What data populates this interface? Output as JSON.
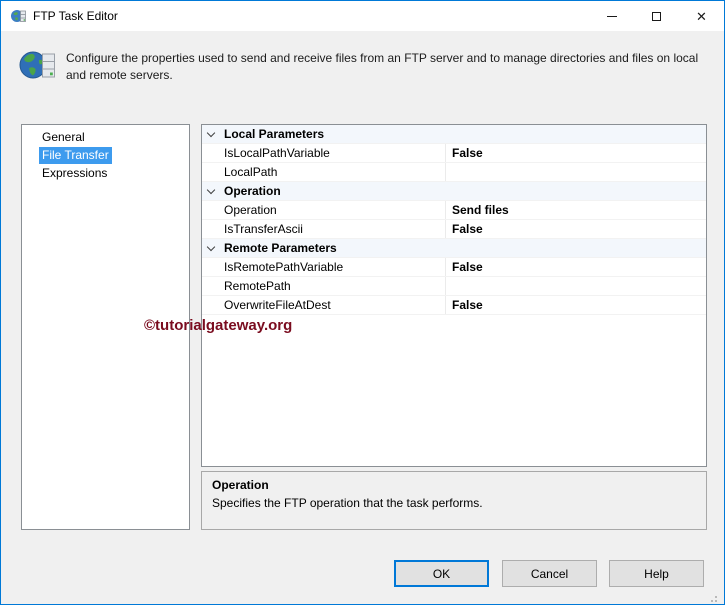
{
  "window": {
    "title": "FTP Task Editor"
  },
  "header": {
    "description": "Configure the properties used to send and receive files from an FTP server and to manage directories and files on local and remote servers."
  },
  "sidebar": {
    "items": [
      {
        "label": "General",
        "selected": false
      },
      {
        "label": "File Transfer",
        "selected": true
      },
      {
        "label": "Expressions",
        "selected": false
      }
    ]
  },
  "property_grid": {
    "rows": [
      {
        "type": "category",
        "label": "Local Parameters"
      },
      {
        "type": "property",
        "name": "IsLocalPathVariable",
        "value": "False"
      },
      {
        "type": "property",
        "name": "LocalPath",
        "value": ""
      },
      {
        "type": "category",
        "label": "Operation"
      },
      {
        "type": "property",
        "name": "Operation",
        "value": "Send files"
      },
      {
        "type": "property",
        "name": "IsTransferAscii",
        "value": "False"
      },
      {
        "type": "category",
        "label": "Remote Parameters"
      },
      {
        "type": "property",
        "name": "IsRemotePathVariable",
        "value": "False"
      },
      {
        "type": "property",
        "name": "RemotePath",
        "value": ""
      },
      {
        "type": "property",
        "name": "OverwriteFileAtDest",
        "value": "False"
      }
    ]
  },
  "watermark": {
    "text": "©tutorialgateway.org"
  },
  "help_panel": {
    "title": "Operation",
    "description": "Specifies the FTP operation that the task performs."
  },
  "footer": {
    "ok": "OK",
    "cancel": "Cancel",
    "help": "Help"
  },
  "colors": {
    "window_border": "#0079d7",
    "selection_blue": "#3d9bee",
    "category_row_bg": "#f3f7fc",
    "watermark_red": "#7a0c1f",
    "ok_focus_border": "#0078d7",
    "dialog_bg": "#f0f0f0"
  }
}
